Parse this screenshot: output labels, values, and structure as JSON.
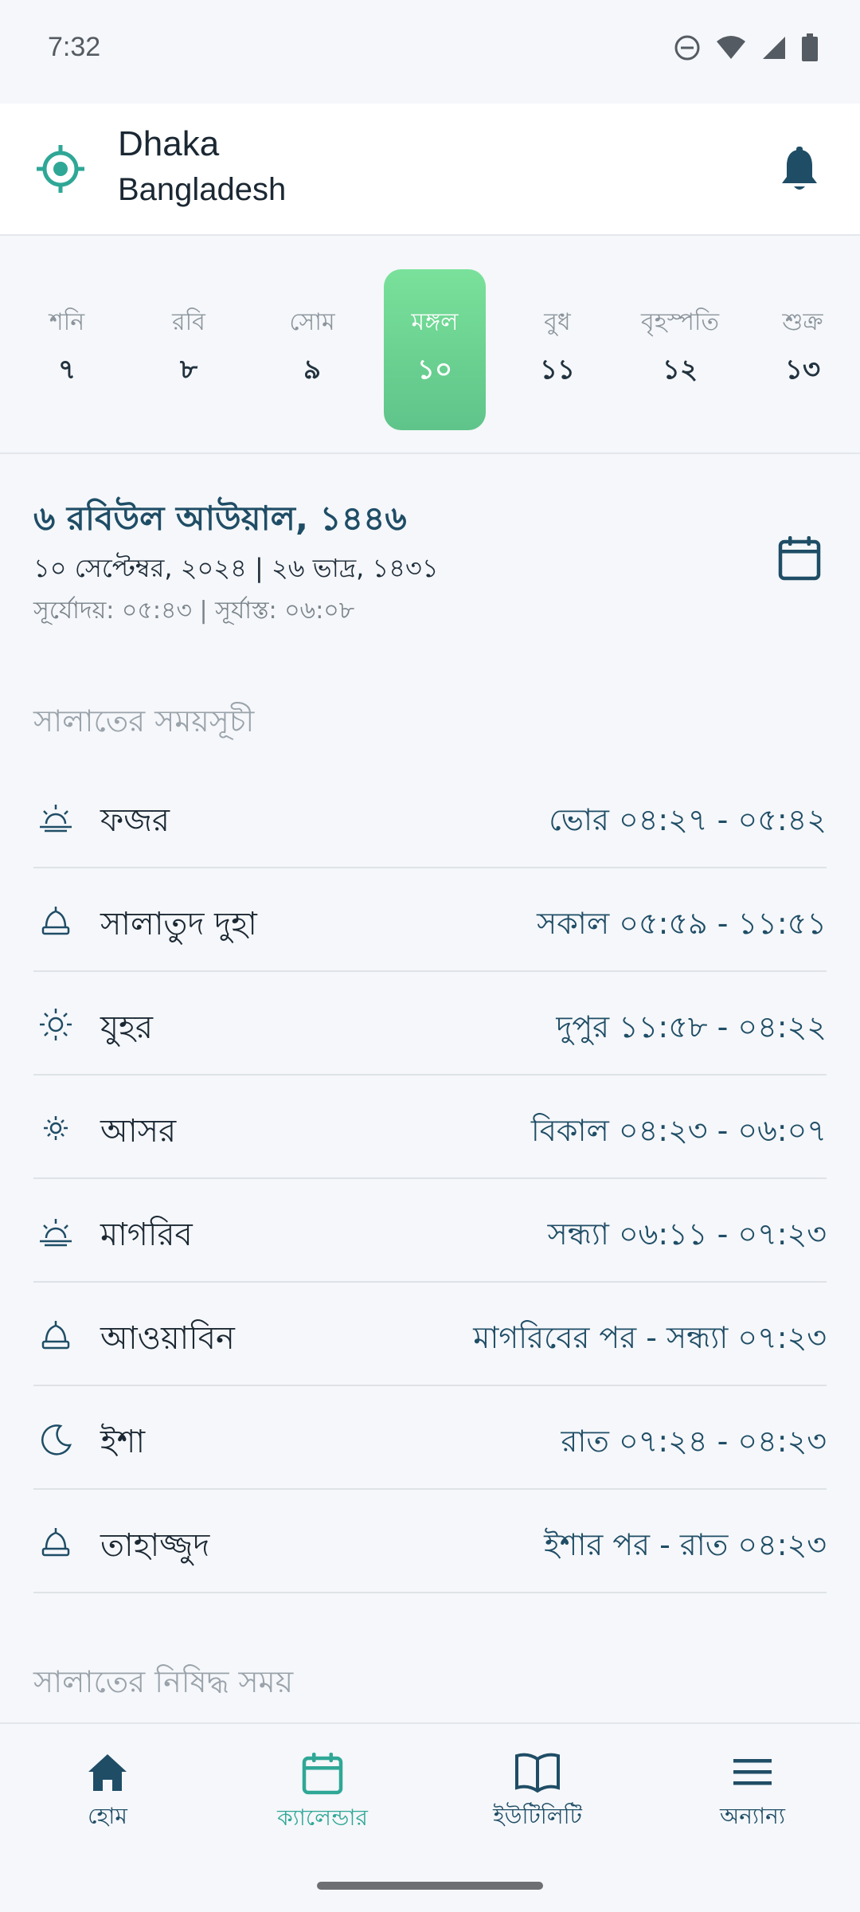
{
  "status_bar": {
    "time": "7:32",
    "icons": [
      "do-not-disturb-icon",
      "wifi-icon",
      "signal-icon",
      "battery-icon"
    ]
  },
  "header": {
    "city": "Dhaka",
    "country": "Bangladesh",
    "location_icon": "location-target-icon",
    "notification_icon": "bell-icon"
  },
  "week": [
    {
      "name": "শনি",
      "num": "৭",
      "active": false
    },
    {
      "name": "রবি",
      "num": "৮",
      "active": false
    },
    {
      "name": "সোম",
      "num": "৯",
      "active": false
    },
    {
      "name": "মঙ্গল",
      "num": "১০",
      "active": true
    },
    {
      "name": "বুধ",
      "num": "১১",
      "active": false
    },
    {
      "name": "বৃহস্পতি",
      "num": "১২",
      "active": false
    },
    {
      "name": "শুক্র",
      "num": "১৩",
      "active": false
    }
  ],
  "date_info": {
    "hijri": "৬ রবিউল আউয়াল, ১৪৪৬",
    "gregorian_bangla": "১০ সেপ্টেম্বর, ২০২৪ | ২৬ ভাদ্র, ১৪৩১",
    "sun_times": "সূর্যোদয়: ০৫:৪৩ | সূর্যাস্ত: ০৬:০৮"
  },
  "prayer_section_title": "সালাতের সময়সূচী",
  "prayers": [
    {
      "name": "ফজর",
      "time": "ভোর ০৪:২৭ -  ০৫:৪২",
      "icon": "sunrise-icon"
    },
    {
      "name": "সালাতুদ দুহা",
      "time": "সকাল ০৫:৫৯ -  ১১:৫১",
      "icon": "mosque-dome-icon"
    },
    {
      "name": "যুহর",
      "time": "দুপুর ১১:৫৮ -  ০৪:২২",
      "icon": "sun-icon"
    },
    {
      "name": "আসর",
      "time": "বিকাল ০৪:২৩ -  ০৬:০৭",
      "icon": "sun-small-icon"
    },
    {
      "name": "মাগরিব",
      "time": "সন্ধ্যা ০৬:১১ -  ০৭:২৩",
      "icon": "sunset-icon"
    },
    {
      "name": "আওয়াবিন",
      "time": "মাগরিবের পর - সন্ধ্যা  ০৭:২৩",
      "icon": "mosque-dome-icon"
    },
    {
      "name": "ইশা",
      "time": "রাত ০৭:২৪ -  ০৪:২৩",
      "icon": "moon-icon"
    },
    {
      "name": "তাহাজ্জুদ",
      "time": "ইশার পর - রাত  ০৪:২৩",
      "icon": "mosque-dome-icon"
    }
  ],
  "forbidden_section_title": "সালাতের নিষিদ্ধ সময়",
  "nav": [
    {
      "label": "হোম",
      "icon": "home-icon",
      "active": false
    },
    {
      "label": "ক্যালেন্ডার",
      "icon": "calendar-icon",
      "active": true
    },
    {
      "label": "ইউটিলিটি",
      "icon": "book-icon",
      "active": false
    },
    {
      "label": "অন্যান্য",
      "icon": "menu-icon",
      "active": false
    }
  ],
  "colors": {
    "accent_green": "#6fd596",
    "primary_dark": "#1f4d66",
    "teal": "#2fa796"
  }
}
